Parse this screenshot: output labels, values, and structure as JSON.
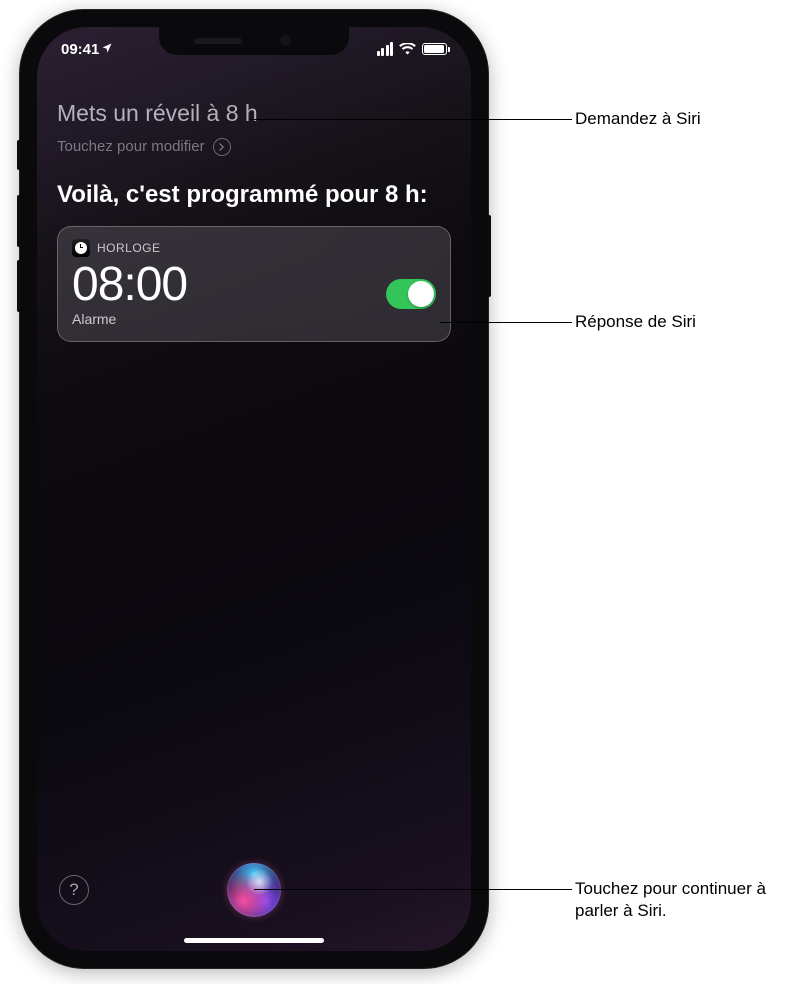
{
  "status": {
    "time": "09:41",
    "location_arrow": "➤"
  },
  "siri": {
    "user_request": "Mets un réveil à 8 h",
    "edit_hint": "Touchez pour modifier",
    "response": "Voilà, c'est programmé pour 8 h:"
  },
  "alarm_card": {
    "app_name": "HORLOGE",
    "time": "08:00",
    "label": "Alarme",
    "enabled": true
  },
  "help_glyph": "?",
  "callouts": {
    "ask": "Demandez à Siri",
    "response": "Réponse de Siri",
    "continue": "Touchez pour continuer à parler à Siri."
  }
}
